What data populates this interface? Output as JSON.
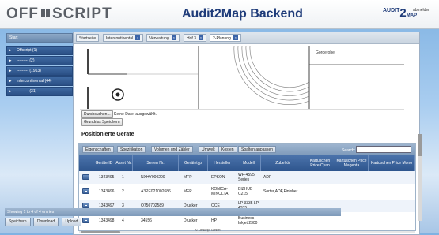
{
  "header": {
    "logo_left": "OFF",
    "logo_right": "SCRIPT",
    "title": "Audit2Map Backend",
    "brand_audit": "AUDIT",
    "brand_num": "2",
    "brand_map": "MAP",
    "logout": "abmelden"
  },
  "sidebar": {
    "start": "Start",
    "items": [
      {
        "label": "Offscript (1)"
      },
      {
        "label": "--------- (2)"
      },
      {
        "label": "--------- (1913)"
      },
      {
        "label": "Intercontinental (44)"
      },
      {
        "label": "--------- (31)"
      }
    ]
  },
  "tabs": [
    {
      "label": "Startseite"
    },
    {
      "label": "Intercontinental"
    },
    {
      "label": "Verwaltung"
    },
    {
      "label": "Hof 3"
    },
    {
      "label": "2-Planung"
    }
  ],
  "floorplan": {
    "label": "Gorderobe"
  },
  "upload": {
    "browse": "Durchsuchen...",
    "no_file": "Keine Datei ausgewählt.",
    "save_plan": "Grundriss Speichern"
  },
  "section_title": "Positionierte Geräte",
  "grid": {
    "toolbar_tabs": [
      "Eigenschaften",
      "Spezifikation",
      "Volumen und Zähler",
      "Umwelt",
      "Kosten",
      "Spalten anpassen"
    ],
    "search_label": "Search:",
    "search_value": "",
    "columns": [
      "",
      "Geräte ID",
      "Asset Nr.",
      "Serien Nr.",
      "Gerätetyp",
      "Hersteller",
      "Modell",
      "Zubehör",
      "Kartuschen Price Cyan",
      "Kartuschen Price Magenta",
      "Kartuschen Price Mono"
    ],
    "rows": [
      [
        "1343495",
        "1",
        "NXHY000200",
        "MFP",
        "EPSON",
        "WP-4595 Series",
        "ADF",
        "",
        "",
        ""
      ],
      [
        "1343496",
        "2",
        "A3PE021002686",
        "MFP",
        "KONICA-MINOLTA",
        "BIZHUB C215",
        "Sorter,ADF,Finisher",
        "",
        "",
        ""
      ],
      [
        "1343497",
        "3",
        "Q750702589",
        "Drucker",
        "OCE",
        "LP 3335 LP 4335",
        "",
        "",
        "",
        ""
      ],
      [
        "1343498",
        "4",
        "34556",
        "Drucker",
        "HP",
        "Business Inkjet 2300",
        "",
        "",
        "",
        ""
      ]
    ],
    "info": "Showing 1 to 4 of 4 entries"
  },
  "buttons": {
    "save": "Speichern",
    "download": "Download",
    "upload": "Upload"
  },
  "copyright": "© Offscript GmbH"
}
